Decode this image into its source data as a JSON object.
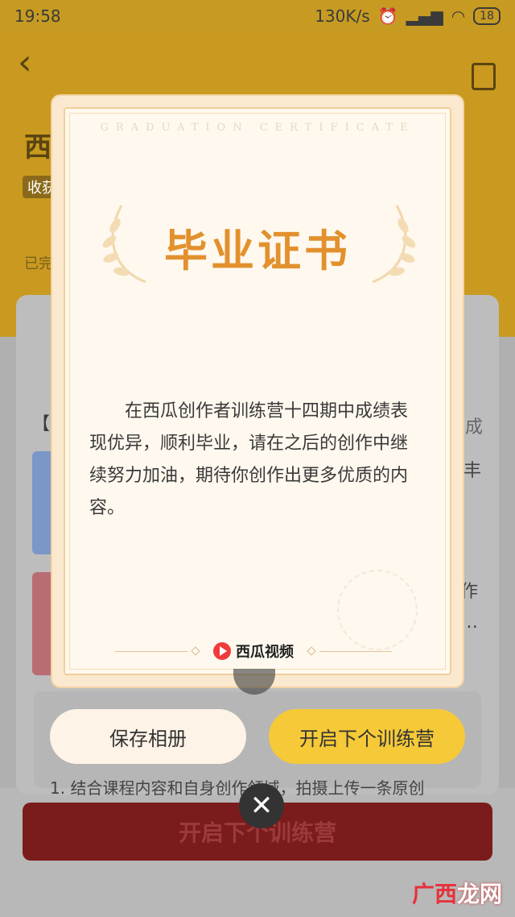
{
  "status_bar": {
    "time": "19:58",
    "speed": "130K/s",
    "battery": "18"
  },
  "background": {
    "title_partial": "西",
    "tag_partial": "收获",
    "done_partial": "已完",
    "left_bracket": "【",
    "right_text_1": "成",
    "right_text_2": "丰",
    "right_text_3": "作",
    "right_text_4": "…",
    "bottom_partial_line": "1. 结合课程内容和自身创作领域，拍摄上传一条原创",
    "bottom_button": "开启下个训练营"
  },
  "certificate": {
    "header": "GRADUATION CERTIFICATE",
    "title": "毕业证书",
    "body": "在西瓜创作者训练营十四期中成绩表现优异，顺利毕业，请在之后的创作中继续努力加油，期待你创作出更多优质的内容。",
    "brand": "西瓜视频"
  },
  "actions": {
    "save_label": "保存相册",
    "next_label": "开启下个训练营"
  },
  "watermark": {
    "left": "广西",
    "right": "龙网"
  },
  "colors": {
    "brand_gold": "#f5c938",
    "title_orange": "#e2912e"
  }
}
